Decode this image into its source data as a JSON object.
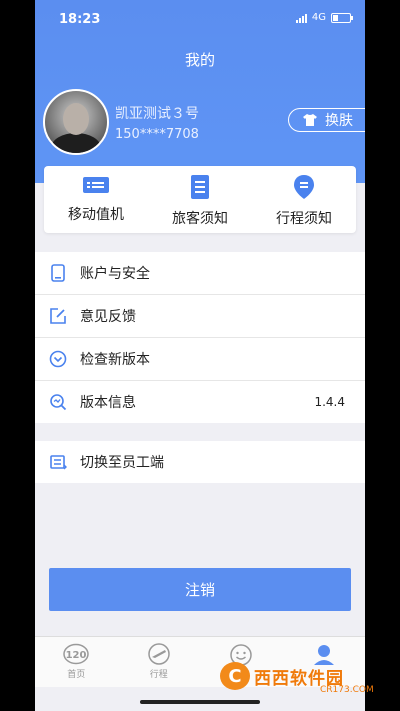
{
  "status": {
    "time": "18:23",
    "network": "4G"
  },
  "header": {
    "title": "我的"
  },
  "profile": {
    "name": "凯亚测试３号",
    "phone": "150****7708",
    "skin_label": "换肤"
  },
  "quick_actions": [
    {
      "label": "移动值机",
      "icon": "boarding-pass-icon"
    },
    {
      "label": "旅客须知",
      "icon": "document-icon"
    },
    {
      "label": "行程须知",
      "icon": "location-pin-icon"
    }
  ],
  "menu": [
    {
      "label": "账户与安全",
      "icon": "phone-icon"
    },
    {
      "label": "意见反馈",
      "icon": "edit-icon"
    },
    {
      "label": "检查新版本",
      "icon": "chevron-circle-icon"
    },
    {
      "label": "版本信息",
      "icon": "search-icon",
      "value": "1.4.4"
    }
  ],
  "switch_menu": {
    "label": "切换至员工端",
    "icon": "switch-icon"
  },
  "logout_label": "注销",
  "tabs": [
    {
      "label": "首页",
      "icon": "home-120-icon"
    },
    {
      "label": "行程",
      "icon": "plane-icon"
    },
    {
      "label": "",
      "icon": "smile-icon"
    },
    {
      "label": "",
      "icon": "user-icon"
    }
  ],
  "watermark": {
    "cn": "西西软件园",
    "en": "CR173.COM"
  },
  "colors": {
    "primary": "#5b8ef0",
    "background": "#efeff4"
  }
}
